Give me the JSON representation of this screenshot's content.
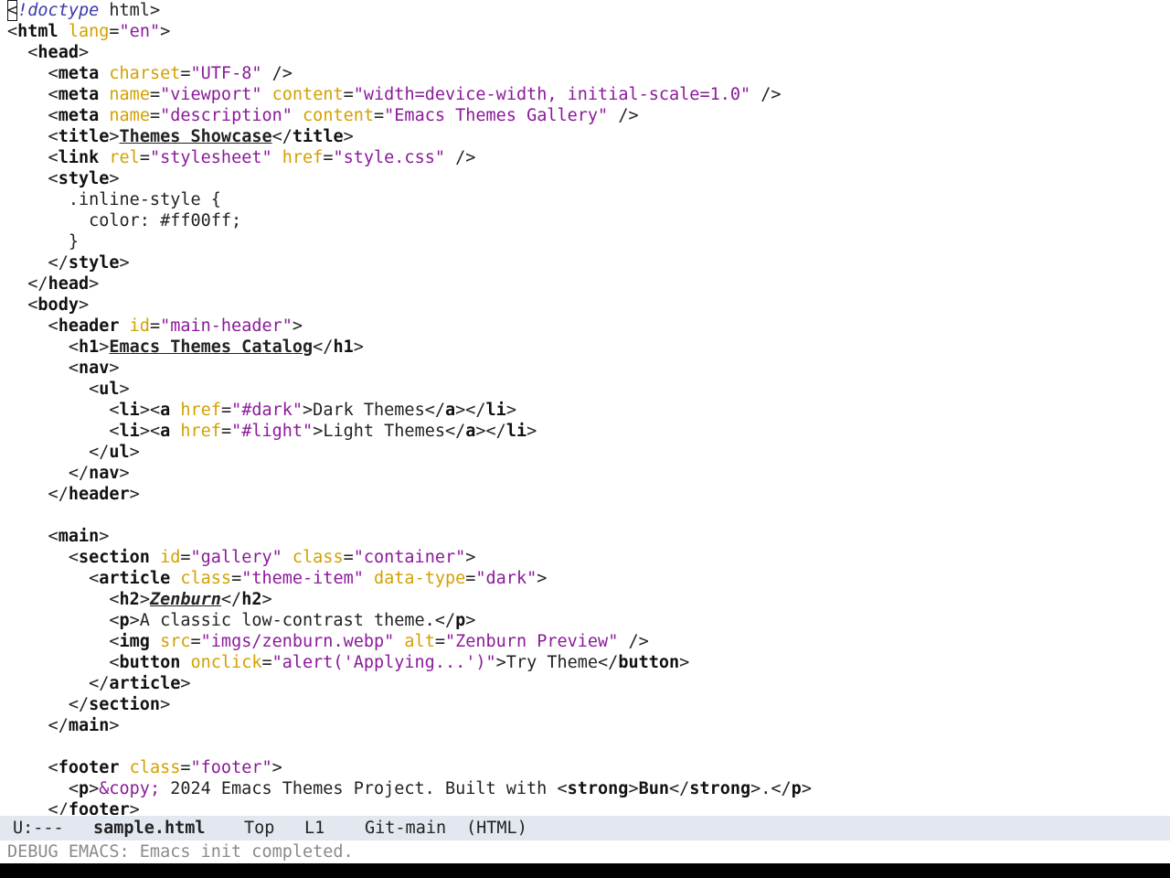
{
  "editor": {
    "lines": [
      [
        {
          "t": "<",
          "c": "cursor"
        },
        {
          "t": "!doctype",
          "c": "kw"
        },
        {
          "t": " html>"
        }
      ],
      [
        {
          "t": "<"
        },
        {
          "t": "html",
          "c": "tag"
        },
        {
          "t": " "
        },
        {
          "t": "lang",
          "c": "attr"
        },
        {
          "t": "="
        },
        {
          "t": "\"en\"",
          "c": "str"
        },
        {
          "t": ">"
        }
      ],
      [
        {
          "t": "  <"
        },
        {
          "t": "head",
          "c": "tag"
        },
        {
          "t": ">"
        }
      ],
      [
        {
          "t": "    <"
        },
        {
          "t": "meta",
          "c": "tag"
        },
        {
          "t": " "
        },
        {
          "t": "charset",
          "c": "attr"
        },
        {
          "t": "="
        },
        {
          "t": "\"UTF-8\"",
          "c": "str"
        },
        {
          "t": " />"
        }
      ],
      [
        {
          "t": "    <"
        },
        {
          "t": "meta",
          "c": "tag"
        },
        {
          "t": " "
        },
        {
          "t": "name",
          "c": "attr"
        },
        {
          "t": "="
        },
        {
          "t": "\"viewport\"",
          "c": "str"
        },
        {
          "t": " "
        },
        {
          "t": "content",
          "c": "attr"
        },
        {
          "t": "="
        },
        {
          "t": "\"width=device-width, initial-scale=1.0\"",
          "c": "str"
        },
        {
          "t": " />"
        }
      ],
      [
        {
          "t": "    <"
        },
        {
          "t": "meta",
          "c": "tag"
        },
        {
          "t": " "
        },
        {
          "t": "name",
          "c": "attr"
        },
        {
          "t": "="
        },
        {
          "t": "\"description\"",
          "c": "str"
        },
        {
          "t": " "
        },
        {
          "t": "content",
          "c": "attr"
        },
        {
          "t": "="
        },
        {
          "t": "\"Emacs Themes Gallery\"",
          "c": "str"
        },
        {
          "t": " />"
        }
      ],
      [
        {
          "t": "    <"
        },
        {
          "t": "title",
          "c": "tag"
        },
        {
          "t": ">"
        },
        {
          "t": "Themes Showcase",
          "c": "ul"
        },
        {
          "t": "</"
        },
        {
          "t": "title",
          "c": "tag"
        },
        {
          "t": ">"
        }
      ],
      [
        {
          "t": "    <"
        },
        {
          "t": "link",
          "c": "tag"
        },
        {
          "t": " "
        },
        {
          "t": "rel",
          "c": "attr"
        },
        {
          "t": "="
        },
        {
          "t": "\"stylesheet\"",
          "c": "str"
        },
        {
          "t": " "
        },
        {
          "t": "href",
          "c": "attr"
        },
        {
          "t": "="
        },
        {
          "t": "\"style.css\"",
          "c": "str"
        },
        {
          "t": " />"
        }
      ],
      [
        {
          "t": "    <"
        },
        {
          "t": "style",
          "c": "tag"
        },
        {
          "t": ">"
        }
      ],
      [
        {
          "t": "      .inline-style {"
        }
      ],
      [
        {
          "t": "        color: #ff00ff;"
        }
      ],
      [
        {
          "t": "      }"
        }
      ],
      [
        {
          "t": "    </"
        },
        {
          "t": "style",
          "c": "tag"
        },
        {
          "t": ">"
        }
      ],
      [
        {
          "t": "  </"
        },
        {
          "t": "head",
          "c": "tag"
        },
        {
          "t": ">"
        }
      ],
      [
        {
          "t": "  <"
        },
        {
          "t": "body",
          "c": "tag"
        },
        {
          "t": ">"
        }
      ],
      [
        {
          "t": "    <"
        },
        {
          "t": "header",
          "c": "tag"
        },
        {
          "t": " "
        },
        {
          "t": "id",
          "c": "attr"
        },
        {
          "t": "="
        },
        {
          "t": "\"main-header\"",
          "c": "str"
        },
        {
          "t": ">"
        }
      ],
      [
        {
          "t": "      <"
        },
        {
          "t": "h1",
          "c": "tag"
        },
        {
          "t": ">"
        },
        {
          "t": "Emacs Themes Catalog",
          "c": "ul"
        },
        {
          "t": "</"
        },
        {
          "t": "h1",
          "c": "tag"
        },
        {
          "t": ">"
        }
      ],
      [
        {
          "t": "      <"
        },
        {
          "t": "nav",
          "c": "tag"
        },
        {
          "t": ">"
        }
      ],
      [
        {
          "t": "        <"
        },
        {
          "t": "ul",
          "c": "tag"
        },
        {
          "t": ">"
        }
      ],
      [
        {
          "t": "          <"
        },
        {
          "t": "li",
          "c": "tag"
        },
        {
          "t": "><"
        },
        {
          "t": "a",
          "c": "tag"
        },
        {
          "t": " "
        },
        {
          "t": "href",
          "c": "attr"
        },
        {
          "t": "="
        },
        {
          "t": "\"#dark\"",
          "c": "str"
        },
        {
          "t": ">Dark Themes</"
        },
        {
          "t": "a",
          "c": "tag"
        },
        {
          "t": "></"
        },
        {
          "t": "li",
          "c": "tag"
        },
        {
          "t": ">"
        }
      ],
      [
        {
          "t": "          <"
        },
        {
          "t": "li",
          "c": "tag"
        },
        {
          "t": "><"
        },
        {
          "t": "a",
          "c": "tag"
        },
        {
          "t": " "
        },
        {
          "t": "href",
          "c": "attr"
        },
        {
          "t": "="
        },
        {
          "t": "\"#light\"",
          "c": "str"
        },
        {
          "t": ">Light Themes</"
        },
        {
          "t": "a",
          "c": "tag"
        },
        {
          "t": "></"
        },
        {
          "t": "li",
          "c": "tag"
        },
        {
          "t": ">"
        }
      ],
      [
        {
          "t": "        </"
        },
        {
          "t": "ul",
          "c": "tag"
        },
        {
          "t": ">"
        }
      ],
      [
        {
          "t": "      </"
        },
        {
          "t": "nav",
          "c": "tag"
        },
        {
          "t": ">"
        }
      ],
      [
        {
          "t": "    </"
        },
        {
          "t": "header",
          "c": "tag"
        },
        {
          "t": ">"
        }
      ],
      [],
      [
        {
          "t": "    <"
        },
        {
          "t": "main",
          "c": "tag"
        },
        {
          "t": ">"
        }
      ],
      [
        {
          "t": "      <"
        },
        {
          "t": "section",
          "c": "tag"
        },
        {
          "t": " "
        },
        {
          "t": "id",
          "c": "attr"
        },
        {
          "t": "="
        },
        {
          "t": "\"gallery\"",
          "c": "str"
        },
        {
          "t": " "
        },
        {
          "t": "class",
          "c": "attr"
        },
        {
          "t": "="
        },
        {
          "t": "\"container\"",
          "c": "str"
        },
        {
          "t": ">"
        }
      ],
      [
        {
          "t": "        <"
        },
        {
          "t": "article",
          "c": "tag"
        },
        {
          "t": " "
        },
        {
          "t": "class",
          "c": "attr"
        },
        {
          "t": "="
        },
        {
          "t": "\"theme-item\"",
          "c": "str"
        },
        {
          "t": " "
        },
        {
          "t": "data-type",
          "c": "attr"
        },
        {
          "t": "="
        },
        {
          "t": "\"dark\"",
          "c": "str"
        },
        {
          "t": ">"
        }
      ],
      [
        {
          "t": "          <"
        },
        {
          "t": "h2",
          "c": "tag"
        },
        {
          "t": ">"
        },
        {
          "t": "Zenburn",
          "c": "uli"
        },
        {
          "t": "</"
        },
        {
          "t": "h2",
          "c": "tag"
        },
        {
          "t": ">"
        }
      ],
      [
        {
          "t": "          <"
        },
        {
          "t": "p",
          "c": "tag"
        },
        {
          "t": ">A classic low-contrast theme.</"
        },
        {
          "t": "p",
          "c": "tag"
        },
        {
          "t": ">"
        }
      ],
      [
        {
          "t": "          <"
        },
        {
          "t": "img",
          "c": "tag"
        },
        {
          "t": " "
        },
        {
          "t": "src",
          "c": "attr"
        },
        {
          "t": "="
        },
        {
          "t": "\"imgs/zenburn.webp\"",
          "c": "str"
        },
        {
          "t": " "
        },
        {
          "t": "alt",
          "c": "attr"
        },
        {
          "t": "="
        },
        {
          "t": "\"Zenburn Preview\"",
          "c": "str"
        },
        {
          "t": " />"
        }
      ],
      [
        {
          "t": "          <"
        },
        {
          "t": "button",
          "c": "tag"
        },
        {
          "t": " "
        },
        {
          "t": "onclick",
          "c": "attr"
        },
        {
          "t": "="
        },
        {
          "t": "\"alert('Applying...')\"",
          "c": "str"
        },
        {
          "t": ">Try Theme</"
        },
        {
          "t": "button",
          "c": "tag"
        },
        {
          "t": ">"
        }
      ],
      [
        {
          "t": "        </"
        },
        {
          "t": "article",
          "c": "tag"
        },
        {
          "t": ">"
        }
      ],
      [
        {
          "t": "      </"
        },
        {
          "t": "section",
          "c": "tag"
        },
        {
          "t": ">"
        }
      ],
      [
        {
          "t": "    </"
        },
        {
          "t": "main",
          "c": "tag"
        },
        {
          "t": ">"
        }
      ],
      [],
      [
        {
          "t": "    <"
        },
        {
          "t": "footer",
          "c": "tag"
        },
        {
          "t": " "
        },
        {
          "t": "class",
          "c": "attr"
        },
        {
          "t": "="
        },
        {
          "t": "\"footer\"",
          "c": "str"
        },
        {
          "t": ">"
        }
      ],
      [
        {
          "t": "      <"
        },
        {
          "t": "p",
          "c": "tag"
        },
        {
          "t": ">"
        },
        {
          "t": "&copy;",
          "c": "str"
        },
        {
          "t": " 2024 Emacs Themes Project. Built with <"
        },
        {
          "t": "strong",
          "c": "tag"
        },
        {
          "t": ">"
        },
        {
          "t": "Bun",
          "c": "tag"
        },
        {
          "t": "</"
        },
        {
          "t": "strong",
          "c": "tag"
        },
        {
          "t": ">.</"
        },
        {
          "t": "p",
          "c": "tag"
        },
        {
          "t": ">"
        }
      ],
      [
        {
          "t": "    </"
        },
        {
          "t": "footer",
          "c": "tag"
        },
        {
          "t": ">"
        }
      ]
    ]
  },
  "modeline": {
    "status": "U:---",
    "buffer_name": "sample.html",
    "position": "Top",
    "line": "L1",
    "vc": "Git-main",
    "mode": "(HTML)"
  },
  "minibuffer": {
    "message": "DEBUG EMACS: Emacs init completed."
  }
}
